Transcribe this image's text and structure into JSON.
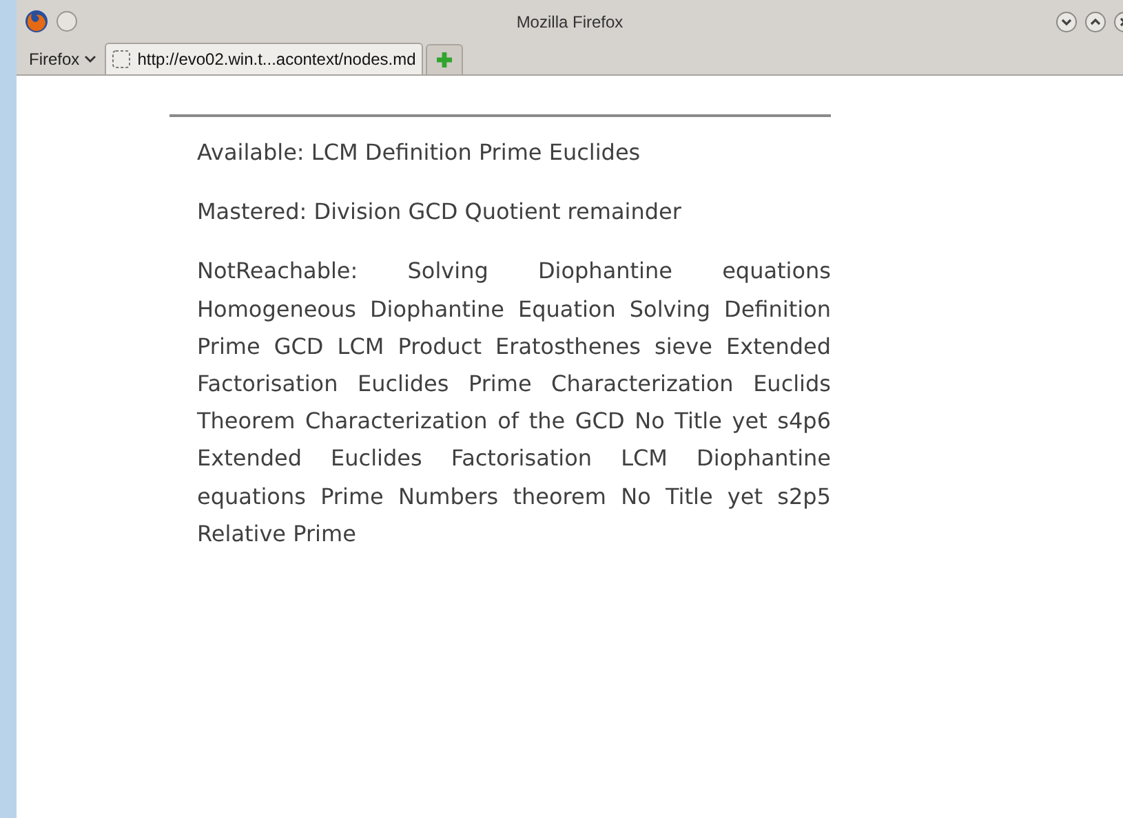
{
  "window": {
    "title": "Mozilla Firefox"
  },
  "menu_button": {
    "label": "Firefox"
  },
  "tabs": [
    {
      "label": "http://evo02.win.t...acontext/nodes.md",
      "selected": true
    }
  ],
  "page": {
    "paragraphs": [
      "Available: LCM Definition Prime Euclides",
      "Mastered: Division GCD Quotient remainder",
      "NotReachable: Solving Diophantine equations Homogeneous Diophantine Equation Solving Definition Prime GCD LCM Product Eratosthenes sieve Extended Factorisation Euclides Prime Characterization Euclids Theorem Characterization of the GCD No Title yet s4p6 Extended Euclides Factorisation LCM Diophantine equations Prime Numbers theorem No Title yet s2p5 Relative Prime"
    ]
  }
}
